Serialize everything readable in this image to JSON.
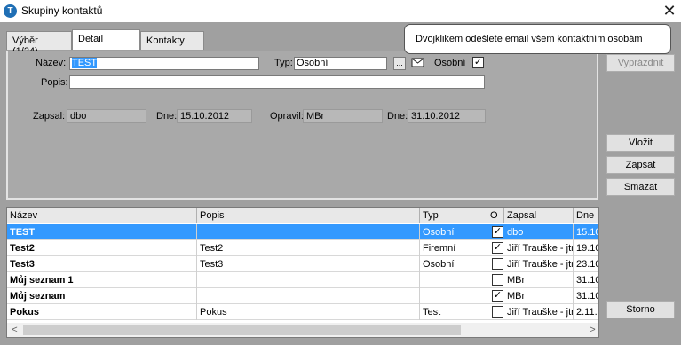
{
  "window": {
    "title": "Skupiny kontaktů",
    "app_icon": "T",
    "close": "✕"
  },
  "tabs": [
    {
      "label": "Výběr (1/24)"
    },
    {
      "label": "Detail"
    },
    {
      "label": "Kontakty"
    }
  ],
  "detail": {
    "nazev_label": "Název:",
    "nazev_value": "TEST",
    "typ_label": "Typ:",
    "typ_value": "Osobní",
    "dots": "...",
    "osobni_label": "Osobní",
    "osobni_checked": "✓",
    "popis_label": "Popis:",
    "popis_value": "",
    "zapsal_label": "Zapsal:",
    "zapsal_value": "dbo",
    "dne1_label": "Dne:",
    "dne1_value": "15.10.2012",
    "opravil_label": "Opravil:",
    "opravil_value": "MBr",
    "dne2_label": "Dne:",
    "dne2_value": "31.10.2012"
  },
  "tooltip": "Dvojklikem odešlete email všem kontaktním osobám",
  "buttons": {
    "vyprazdnit": "Vyprázdnit",
    "vlozit": "Vložit",
    "zapsat": "Zapsat",
    "smazat": "Smazat",
    "storno": "Storno"
  },
  "grid": {
    "headers": [
      "Název",
      "Popis",
      "Typ",
      "O",
      "Zapsal",
      "Dne"
    ],
    "rows": [
      {
        "nazev": "TEST",
        "popis": "",
        "typ": "Osobní",
        "o": "✓",
        "zapsal": "dbo",
        "dne": "15.10"
      },
      {
        "nazev": "Test2",
        "popis": "Test2",
        "typ": "Firemní",
        "o": "✓",
        "zapsal": "Jiří Trauške - jtr",
        "dne": "19.10"
      },
      {
        "nazev": "Test3",
        "popis": "Test3",
        "typ": "Osobní",
        "o": "",
        "zapsal": "Jiří Trauške - jtr",
        "dne": "23.10"
      },
      {
        "nazev": "Můj seznam 1",
        "popis": "",
        "typ": "",
        "o": "",
        "zapsal": "MBr",
        "dne": "31.10"
      },
      {
        "nazev": "Můj seznam",
        "popis": "",
        "typ": "",
        "o": "✓",
        "zapsal": "MBr",
        "dne": "31.10"
      },
      {
        "nazev": "Pokus",
        "popis": "Pokus",
        "typ": "Test",
        "o": "",
        "zapsal": "Jiří Trauške - jtr",
        "dne": "2.11.2"
      }
    ],
    "scroll_left": "<",
    "scroll_right": ">"
  }
}
